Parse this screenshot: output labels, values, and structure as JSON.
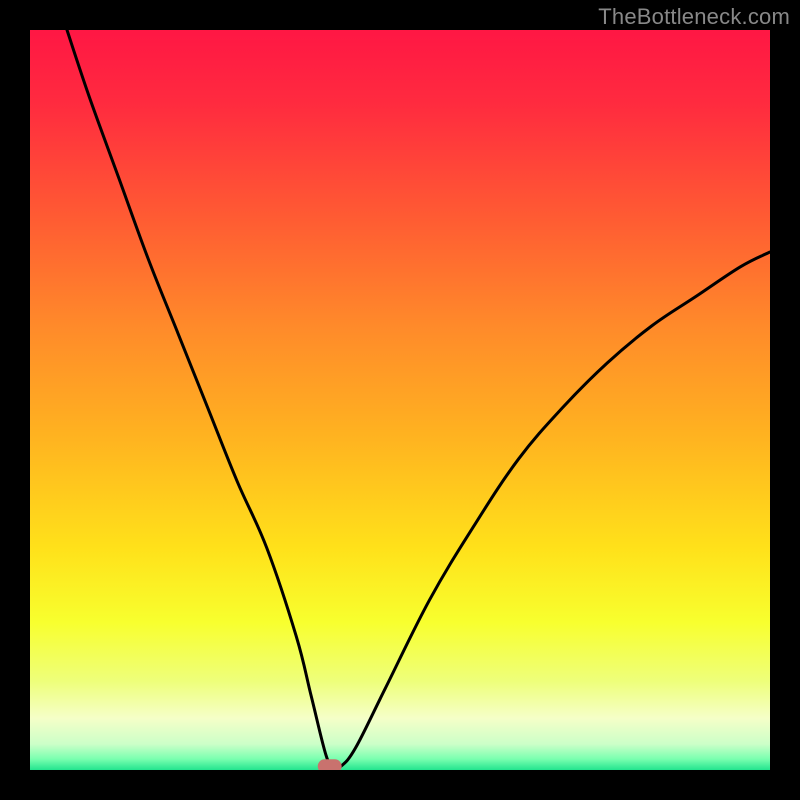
{
  "watermark": "TheBottleneck.com",
  "colors": {
    "frame": "#000000",
    "curve": "#000000",
    "marker_fill": "#c9726e",
    "gradient_stops": [
      {
        "offset": 0.0,
        "color": "#ff1744"
      },
      {
        "offset": 0.1,
        "color": "#ff2b3f"
      },
      {
        "offset": 0.25,
        "color": "#ff5a33"
      },
      {
        "offset": 0.4,
        "color": "#ff8a2a"
      },
      {
        "offset": 0.55,
        "color": "#ffb320"
      },
      {
        "offset": 0.7,
        "color": "#ffe11a"
      },
      {
        "offset": 0.8,
        "color": "#f8ff2e"
      },
      {
        "offset": 0.88,
        "color": "#eeff7a"
      },
      {
        "offset": 0.93,
        "color": "#f5ffc8"
      },
      {
        "offset": 0.965,
        "color": "#ccffc8"
      },
      {
        "offset": 0.985,
        "color": "#7affb0"
      },
      {
        "offset": 1.0,
        "color": "#23e48e"
      }
    ]
  },
  "chart_data": {
    "type": "line",
    "title": "",
    "xlabel": "",
    "ylabel": "",
    "xlim": [
      0,
      100
    ],
    "ylim": [
      0,
      100
    ],
    "grid": false,
    "legend": false,
    "marker": {
      "x": 40.5,
      "y": 0.5,
      "shape": "rounded-rect"
    },
    "series": [
      {
        "name": "bottleneck-curve",
        "x": [
          5,
          8,
          12,
          16,
          20,
          24,
          28,
          32,
          36,
          38,
          40,
          41,
          42,
          44,
          48,
          54,
          60,
          66,
          72,
          78,
          84,
          90,
          96,
          100
        ],
        "values": [
          100,
          91,
          80,
          69,
          59,
          49,
          39,
          30,
          18,
          10,
          2,
          0.5,
          0.5,
          3,
          11,
          23,
          33,
          42,
          49,
          55,
          60,
          64,
          68,
          70
        ]
      }
    ]
  }
}
